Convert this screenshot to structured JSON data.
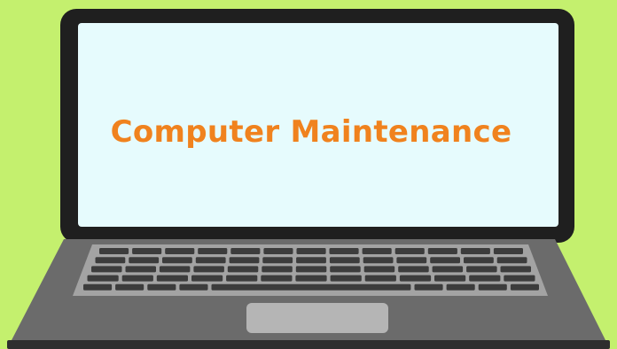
{
  "screen": {
    "title": "Computer Maintenance"
  },
  "colors": {
    "background": "#c4f06e",
    "laptop_frame": "#1f1f1f",
    "screen": "#e6fbfd",
    "title_text": "#f0821e",
    "base": "#6b6b6b",
    "keyboard_tray": "#a3a3a3",
    "keys": "#3c3c3c",
    "touchpad": "#b5b5b5"
  },
  "illustration": {
    "subject": "laptop-icon",
    "keyboard_rows": 5
  }
}
